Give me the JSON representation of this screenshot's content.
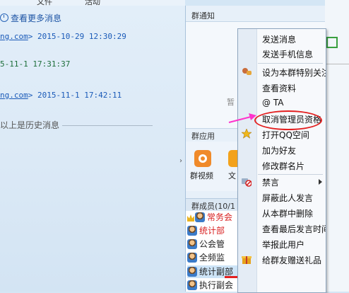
{
  "top_strip": {
    "fragment_1": "文件",
    "fragment_2": "活动"
  },
  "chat": {
    "more_history_link": "查看更多消息",
    "messages": [
      {
        "user_fragment": "ng.com",
        "time": "2015-10-29 12:30:29"
      },
      {
        "user_fragment": "",
        "time": "5-11-1 17:31:37"
      },
      {
        "user_fragment": "ng.com",
        "time": "2015-11-1 17:42:11"
      }
    ],
    "history_note": "以上是历史消息"
  },
  "side_panel": {
    "notice_title": "群通知",
    "notice_placeholder": "暂",
    "apps_title": "群应用",
    "apps": [
      {
        "label": "群视频",
        "color": "#f08a2a"
      },
      {
        "label": "文",
        "color": "#f3a21c"
      }
    ],
    "members_title": "群成员(10/1",
    "members": [
      {
        "name": "常务会",
        "color": "#d81f1f",
        "selected": false
      },
      {
        "name": "统计部",
        "color": "#d81f1f",
        "selected": false
      },
      {
        "name": "公会管",
        "color": "#111111",
        "selected": false
      },
      {
        "name": "全频监",
        "color": "#111111",
        "selected": false
      },
      {
        "name": "统计副部",
        "color": "#111111",
        "selected": true
      },
      {
        "name": "执行副会",
        "color": "#111111",
        "selected": false
      }
    ]
  },
  "context_menu": {
    "items": [
      "发送消息",
      "发送手机信息",
      "设为本群特别关注",
      "查看资料",
      "@ TA",
      "取消管理员资格",
      "打开QQ空间",
      "加为好友",
      "修改群名片",
      "禁言",
      "屏蔽此人发言",
      "从本群中删除",
      "查看最后发言时间",
      "举报此用户",
      "给群友赠送礼品"
    ],
    "highlighted_item": "取消管理员资格",
    "annotation_color": "#e32020",
    "pointer_color": "#ff33cc"
  }
}
